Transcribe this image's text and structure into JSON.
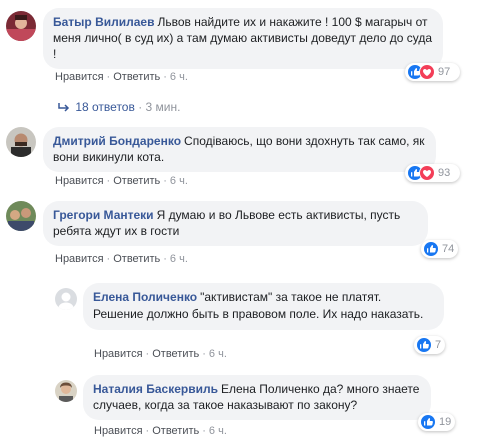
{
  "comments": [
    {
      "author": "Батыр Вилилаев",
      "text": "Львов найдите их и накажите ! 100 $ магарыч от меня лично( в суд их) а там думаю активисты доведут дело до суда !",
      "like": "Нравится",
      "reply": "Ответить",
      "time": "6 ч.",
      "reactions": [
        "like",
        "love"
      ],
      "count": "97"
    },
    {
      "author": "Дмитрий Бондаренко",
      "text": "Сподіваюсь, що вони здохнуть так само, як вони викинули кота.",
      "like": "Нравится",
      "reply": "Ответить",
      "time": "6 ч.",
      "reactions": [
        "like",
        "love"
      ],
      "count": "93"
    },
    {
      "author": "Грегори Мантеки",
      "text": "Я думаю и во Львове есть активисты, пусть ребята ждут их в гости",
      "like": "Нравится",
      "reply": "Ответить",
      "time": "6 ч.",
      "reactions": [
        "like"
      ],
      "count": "74"
    }
  ],
  "replies_summary": {
    "label": "18 ответов",
    "time": "3 мин."
  },
  "replies": [
    {
      "author": "Елена Поличенко",
      "text": "\"активистам\" за такое не платят. Решение должно быть в правовом поле. Их надо наказать.",
      "like": "Нравится",
      "reply": "Ответить",
      "time": "6 ч.",
      "reactions": [
        "like"
      ],
      "count": "7"
    },
    {
      "author": "Наталия Баскервиль",
      "text": "Елена Поличенко да? много знаете случаев, когда за такое наказывают по закону?",
      "like": "Нравится",
      "reply": "Ответить",
      "time": "6 ч.",
      "reactions": [
        "like"
      ],
      "count": "19"
    }
  ],
  "dot": "·",
  "colors": {
    "name_link": "#385898",
    "bubble": "#f2f3f5",
    "like_blue": "#1877f2",
    "love_red": "#f33e58"
  }
}
